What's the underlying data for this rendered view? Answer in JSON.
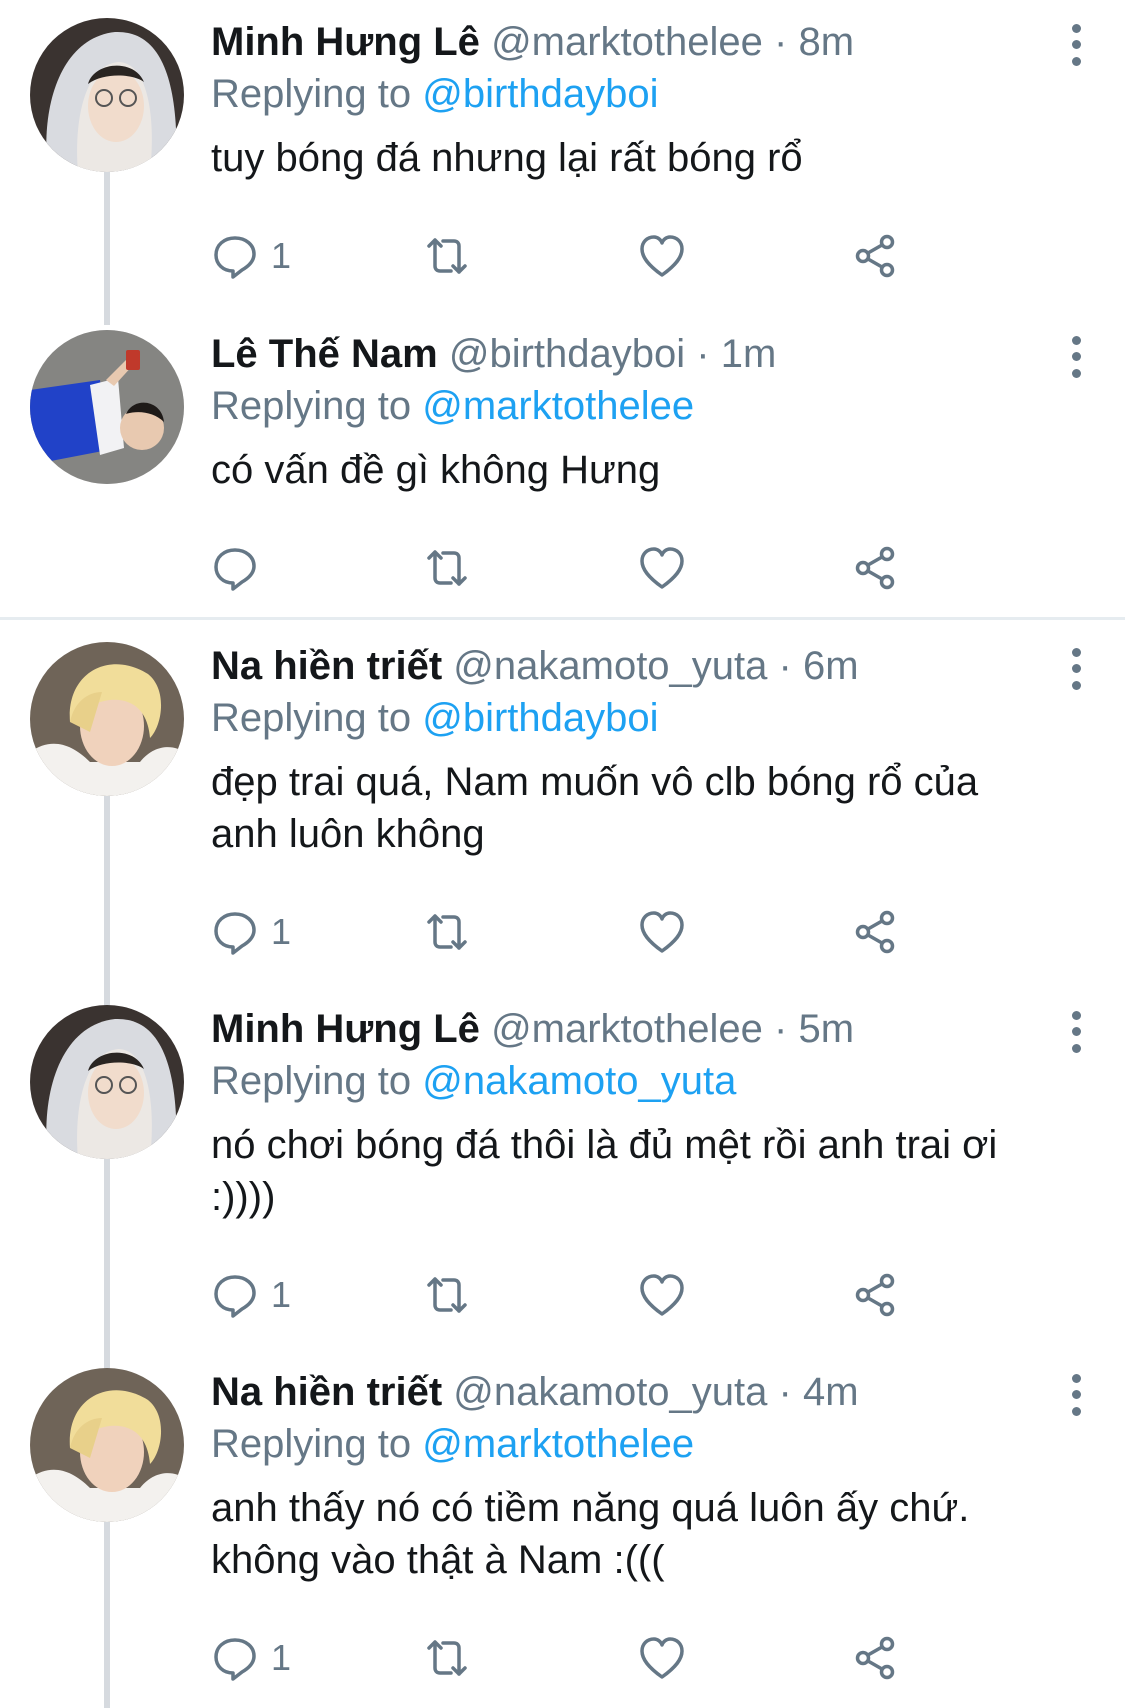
{
  "tweets": [
    {
      "name": "Minh Hưng Lê",
      "handle": "@marktothelee",
      "time": "8m",
      "replying_prefix": "Replying to",
      "replying_to": "@birthdayboi",
      "text": "tuy bóng đá nhưng lại rất bóng rổ",
      "reply_count": "1",
      "avatar": "gray-hoodie-avatar"
    },
    {
      "name": "Lê Thế Nam",
      "handle": "@birthdayboi",
      "time": "1m",
      "replying_prefix": "Replying to",
      "replying_to": "@marktothelee",
      "text": "có vấn đề gì không Hưng",
      "reply_count": "",
      "avatar": "lying-on-ground-avatar"
    },
    {
      "name": "Na hiền triết",
      "handle": "@nakamoto_yuta",
      "time": "6m",
      "replying_prefix": "Replying to",
      "replying_to": "@birthdayboi",
      "text": "đẹp trai quá, Nam muốn vô clb bóng rổ của anh luôn không",
      "reply_count": "1",
      "avatar": "blonde-hair-avatar"
    },
    {
      "name": "Minh Hưng Lê",
      "handle": "@marktothelee",
      "time": "5m",
      "replying_prefix": "Replying to",
      "replying_to": "@nakamoto_yuta",
      "text": "nó chơi bóng đá thôi là đủ mệt rồi anh trai ơi :))))",
      "reply_count": "1",
      "avatar": "gray-hoodie-avatar"
    },
    {
      "name": "Na hiền triết",
      "handle": "@nakamoto_yuta",
      "time": "4m",
      "replying_prefix": "Replying to",
      "replying_to": "@marktothelee",
      "text": "anh thấy nó có tiềm năng quá luôn ấy chứ. không vào thật à Nam :(((",
      "reply_count": "1",
      "avatar": "blonde-hair-avatar"
    }
  ],
  "separator_char": "·",
  "colors": {
    "link": "#1da1f2",
    "secondary": "#657786",
    "primary": "#14171a",
    "divider": "#e6ecf0"
  }
}
